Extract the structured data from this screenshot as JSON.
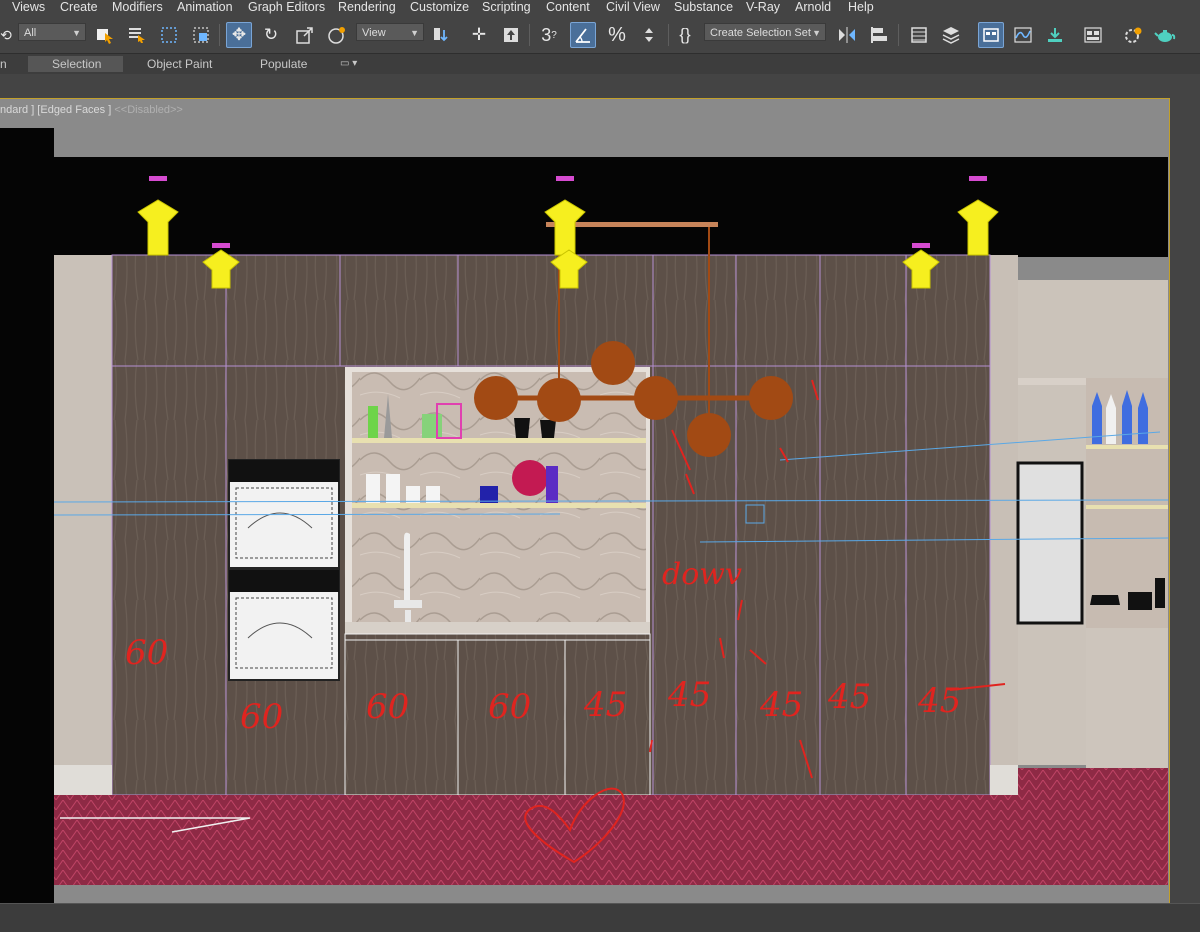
{
  "menu": {
    "items": [
      "Views",
      "Create",
      "Modifiers",
      "Animation",
      "Graph Editors",
      "Rendering",
      "Customize",
      "Scripting",
      "Content",
      "Civil View",
      "Substance",
      "V-Ray",
      "Arnold",
      "Help"
    ]
  },
  "toolbar": {
    "filter_value": "All",
    "coord_value": "View",
    "selection_set_value": "Create Selection Set",
    "snap_label": "3"
  },
  "ribbon": {
    "tabs": [
      "n",
      "Selection",
      "Object Paint",
      "Populate"
    ]
  },
  "viewport": {
    "label": "ndard ] [Edged Faces ]",
    "label_disabled": "<<Disabled>>",
    "annotations": {
      "a1": "60",
      "a2": "60",
      "a3": "60",
      "a4": "60",
      "a5": "45",
      "a6": "45",
      "a7": "45",
      "a8": "45",
      "a9": "45",
      "scribble": "dowv"
    }
  },
  "colors": {
    "accent": "#4a6f99",
    "viewport_border": "#c2a02a",
    "wood": "#5d5048",
    "annotation_red": "#e0241f",
    "floor": "#a3294a"
  }
}
